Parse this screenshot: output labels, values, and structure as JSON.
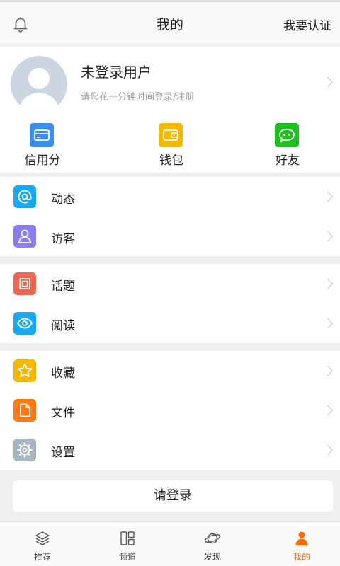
{
  "header": {
    "title": "我的",
    "cert_label": "我要认证"
  },
  "profile": {
    "name": "未登录用户",
    "hint": "请您花一分钟时间登录/注册"
  },
  "quick_actions": [
    {
      "label": "信用分",
      "icon": "credit-card-icon",
      "color": "#3a8ef0"
    },
    {
      "label": "钱包",
      "icon": "wallet-icon",
      "color": "#f5b800"
    },
    {
      "label": "好友",
      "icon": "friends-chat-icon",
      "color": "#1fbf1f"
    }
  ],
  "groups": [
    {
      "items": [
        {
          "label": "动态",
          "icon": "at-icon",
          "color": "#1aa9f0"
        },
        {
          "label": "访客",
          "icon": "visitor-icon",
          "color": "#8b7cf0"
        }
      ]
    },
    {
      "items": [
        {
          "label": "话题",
          "icon": "topic-icon",
          "color": "#f2654f"
        },
        {
          "label": "阅读",
          "icon": "eye-icon",
          "color": "#1aa9f0"
        }
      ]
    },
    {
      "items": [
        {
          "label": "收藏",
          "icon": "star-icon",
          "color": "#f5b800"
        },
        {
          "label": "文件",
          "icon": "file-icon",
          "color": "#ff7a15"
        },
        {
          "label": "设置",
          "icon": "gear-icon",
          "color": "#a8b6c2"
        }
      ]
    }
  ],
  "login_button": "请登录",
  "tabs": [
    {
      "label": "推荐",
      "icon": "layers-icon"
    },
    {
      "label": "频道",
      "icon": "channels-icon"
    },
    {
      "label": "发现",
      "icon": "planet-icon"
    },
    {
      "label": "我的",
      "icon": "person-icon",
      "active": true
    }
  ],
  "colors": {
    "accent": "#ff6a00",
    "background": "#efefef"
  }
}
